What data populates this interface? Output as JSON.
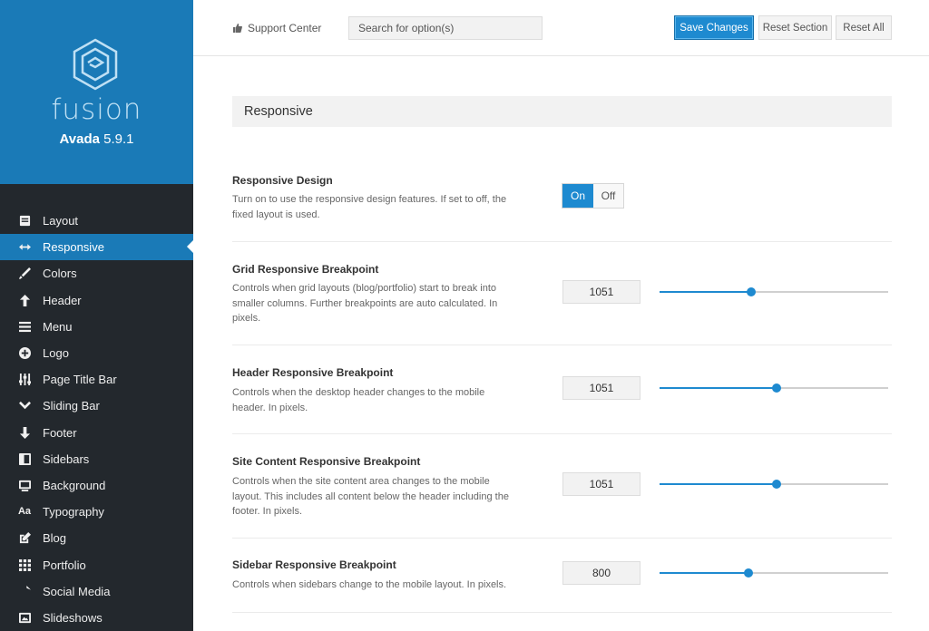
{
  "brand": {
    "name": "fusion",
    "product": "Avada",
    "version": "5.9.1"
  },
  "colors": {
    "accent": "#1e8ad0",
    "sidebar": "#23282d",
    "brand_bg": "#1a7ab7"
  },
  "sidebar": {
    "items": [
      {
        "label": "Layout",
        "icon": "layout-icon"
      },
      {
        "label": "Responsive",
        "icon": "arrows-horizontal-icon",
        "active": true
      },
      {
        "label": "Colors",
        "icon": "brush-icon"
      },
      {
        "label": "Header",
        "icon": "arrow-up-icon"
      },
      {
        "label": "Menu",
        "icon": "menu-icon"
      },
      {
        "label": "Logo",
        "icon": "plus-circle-icon"
      },
      {
        "label": "Page Title Bar",
        "icon": "sliders-icon"
      },
      {
        "label": "Sliding Bar",
        "icon": "chevron-down-icon"
      },
      {
        "label": "Footer",
        "icon": "arrow-down-icon"
      },
      {
        "label": "Sidebars",
        "icon": "sidebars-icon"
      },
      {
        "label": "Background",
        "icon": "monitor-icon"
      },
      {
        "label": "Typography",
        "icon": "typography-icon"
      },
      {
        "label": "Blog",
        "icon": "edit-icon"
      },
      {
        "label": "Portfolio",
        "icon": "grid-icon"
      },
      {
        "label": "Social Media",
        "icon": "share-icon"
      },
      {
        "label": "Slideshows",
        "icon": "image-icon"
      }
    ]
  },
  "topbar": {
    "support_label": "Support Center",
    "search_placeholder": "Search for option(s)",
    "save_label": "Save Changes",
    "reset_section_label": "Reset Section",
    "reset_all_label": "Reset All"
  },
  "section": {
    "title": "Responsive"
  },
  "options": {
    "responsive_design": {
      "title": "Responsive Design",
      "desc": "Turn on to use the responsive design features. If set to off, the fixed layout is used.",
      "on_label": "On",
      "off_label": "Off",
      "value": "On"
    },
    "grid_breakpoint": {
      "title": "Grid Responsive Breakpoint",
      "desc": "Controls when grid layouts (blog/portfolio) start to break into smaller columns. Further breakpoints are auto calculated. In pixels.",
      "value": "1051",
      "fraction": 0.4
    },
    "header_breakpoint": {
      "title": "Header Responsive Breakpoint",
      "desc": "Controls when the desktop header changes to the mobile header. In pixels.",
      "value": "1051",
      "fraction": 0.51
    },
    "content_breakpoint": {
      "title": "Site Content Responsive Breakpoint",
      "desc": "Controls when the site content area changes to the mobile layout. This includes all content below the header including the footer. In pixels.",
      "value": "1051",
      "fraction": 0.51
    },
    "sidebar_breakpoint": {
      "title": "Sidebar Responsive Breakpoint",
      "desc": "Controls when sidebars change to the mobile layout. In pixels.",
      "value": "800",
      "fraction": 0.39
    }
  }
}
